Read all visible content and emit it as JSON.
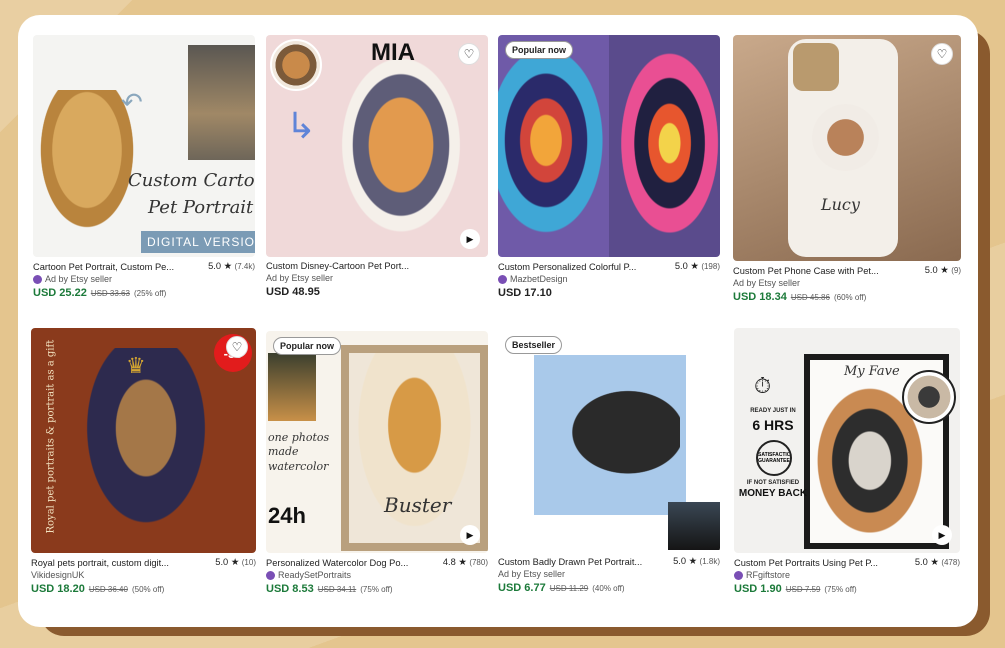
{
  "listings": [
    {
      "title": "Cartoon Pet Portrait, Custom Pe...",
      "rating": "5.0",
      "reviews": "(7.4k)",
      "seller": "Ad by Etsy seller",
      "price": "USD 25.22",
      "old_price": "USD 33.63",
      "discount": "(25% off)",
      "image_text": [
        "Custom Cartoon",
        "Pet Portrait",
        "DIGITAL VERSION"
      ]
    },
    {
      "title": "Custom Disney-Cartoon Pet Port...",
      "seller": "Ad by Etsy seller",
      "price": "USD 48.95",
      "image_text": [
        "MIA"
      ]
    },
    {
      "badge": "Popular now",
      "title": "Custom Personalized Colorful P...",
      "rating": "5.0",
      "reviews": "(198)",
      "seller": "MazbetDesign",
      "price": "USD 17.10"
    },
    {
      "title": "Custom Pet Phone Case with Pet...",
      "rating": "5.0",
      "reviews": "(9)",
      "seller": "Ad by Etsy seller",
      "price": "USD 18.34",
      "old_price": "USD 45.86",
      "discount": "(60% off)",
      "image_text": [
        "Lucy"
      ]
    },
    {
      "title": "Royal pets portrait, custom digit...",
      "rating": "5.0",
      "reviews": "(10)",
      "seller": "VikidesignUK",
      "price": "USD 18.20",
      "old_price": "USD 36.40",
      "discount": "(50% off)",
      "image_text": [
        "Royal pet portraits & portrait as a gift",
        "-50"
      ]
    },
    {
      "badge": "Popular now",
      "title": "Personalized Watercolor Dog Po...",
      "rating": "4.8",
      "reviews": "(780)",
      "seller": "ReadySetPortraits",
      "price": "USD 8.53",
      "old_price": "USD 34.11",
      "discount": "(75% off)",
      "image_text": [
        "one photos made watercolor",
        "24h",
        "Buster"
      ]
    },
    {
      "badge": "Bestseller",
      "title": "Custom Badly Drawn Pet Portrait...",
      "rating": "5.0",
      "reviews": "(1.8k)",
      "seller": "Ad by Etsy seller",
      "price": "USD 6.77",
      "old_price": "USD 11.29",
      "discount": "(40% off)"
    },
    {
      "title": "Custom Pet Portraits Using Pet P...",
      "rating": "5.0",
      "reviews": "(478)",
      "seller": "RFgiftstore",
      "price": "USD 1.90",
      "old_price": "USD 7.59",
      "discount": "(75% off)",
      "image_text": [
        "My Fave",
        "READY JUST IN",
        "6 HRS",
        "SATISFACTION GUARANTEE",
        "IF NOT SATISFIED",
        "MONEY BACK"
      ]
    }
  ],
  "icons": {
    "favorite": "heart-icon",
    "play": "play-icon",
    "star": "star-icon"
  },
  "colors": {
    "price_green": "#1c7a3a",
    "card_bg": "#ffffff",
    "page_bg": "#e4c58e"
  }
}
